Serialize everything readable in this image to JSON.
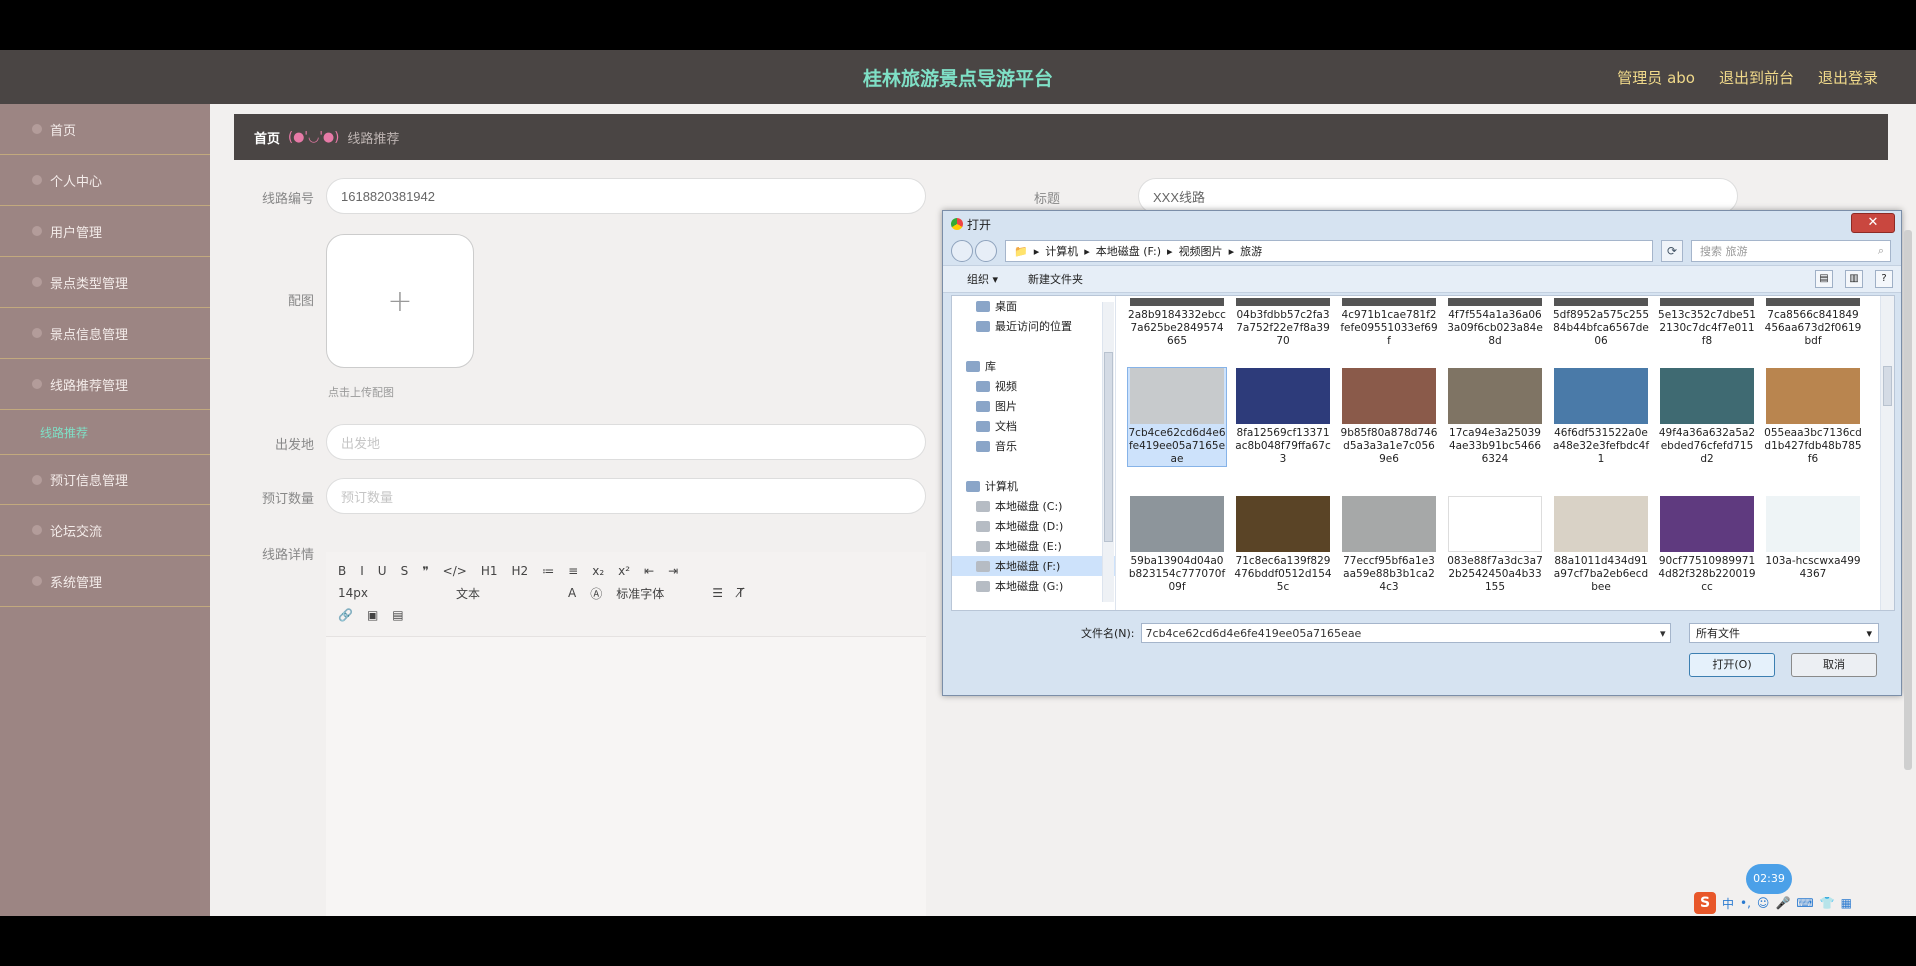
{
  "app": {
    "title": "桂林旅游景点导游平台",
    "user": "管理员 abo",
    "to_front": "退出到前台",
    "logout": "退出登录"
  },
  "sidebar": {
    "items": [
      {
        "label": "首页"
      },
      {
        "label": "个人中心"
      },
      {
        "label": "用户管理"
      },
      {
        "label": "景点类型管理"
      },
      {
        "label": "景点信息管理"
      },
      {
        "label": "线路推荐管理"
      }
    ],
    "sub_item": "线路推荐",
    "items2": [
      {
        "label": "预订信息管理"
      },
      {
        "label": "论坛交流"
      },
      {
        "label": "系统管理"
      }
    ]
  },
  "breadcrumb": {
    "home": "首页",
    "sep": "(●'◡'●)",
    "current": "线路推荐"
  },
  "form": {
    "route_no_label": "线路编号",
    "route_no_value": "1618820381942",
    "title_label": "标题",
    "title_value": "XXX线路",
    "cover_label": "配图",
    "upload_hint": "点击上传配图",
    "departure_label": "出发地",
    "departure_placeholder": "出发地",
    "quantity_label": "预订数量",
    "quantity_placeholder": "预订数量",
    "detail_label": "线路详情"
  },
  "editor": {
    "toolbar_row1": [
      "B",
      "I",
      "U",
      "S",
      "❞",
      "</>",
      "H1",
      "H2",
      "≔",
      "≡",
      "x₂",
      "x²",
      "⇤",
      "⇥"
    ],
    "font_size": "14px",
    "block_type": "文本",
    "font_family": "标准字体",
    "toolbar_row3": [
      "🔗",
      "▣",
      "▤"
    ]
  },
  "dialog": {
    "title": "打开",
    "path": [
      "计算机",
      "本地磁盘 (F:)",
      "视频图片",
      "旅游"
    ],
    "search_placeholder": "搜索 旅游",
    "organize": "组织 ▾",
    "new_folder": "新建文件夹",
    "tree": [
      {
        "label": "桌面",
        "type": "folder"
      },
      {
        "label": "最近访问的位置",
        "type": "folder"
      },
      {
        "label": "",
        "type": "spacer"
      },
      {
        "label": "库",
        "type": "lib"
      },
      {
        "label": "视频",
        "type": "folder"
      },
      {
        "label": "图片",
        "type": "folder"
      },
      {
        "label": "文档",
        "type": "folder"
      },
      {
        "label": "音乐",
        "type": "folder"
      },
      {
        "label": "",
        "type": "spacer"
      },
      {
        "label": "计算机",
        "type": "lib"
      },
      {
        "label": "本地磁盘 (C:)",
        "type": "drive"
      },
      {
        "label": "本地磁盘 (D:)",
        "type": "drive"
      },
      {
        "label": "本地磁盘 (E:)",
        "type": "drive"
      },
      {
        "label": "本地磁盘 (F:)",
        "type": "drive",
        "selected": true
      },
      {
        "label": "本地磁盘 (G:)",
        "type": "drive"
      }
    ],
    "top_row": [
      "2a8b9184332ebcc7a625be2849574665",
      "04b3fdbb57c2fa37a752f22e7f8a3970",
      "4c971b1cae781f2fefe09551033ef69f",
      "4f7f554a1a36a063a09f6cb023a84e8d",
      "5df8952a575c25584b44bfca6567de06",
      "5e13c352c7dbe512130c7dc4f7e011f8",
      "7ca8566c841849456aa673d2f0619bdf"
    ],
    "mid_row": [
      "7cb4ce62cd6d4e6fe419ee05a7165eae",
      "8fa12569cf13371ac8b048f79ffa67c3",
      "9b85f80a878d746d5a3a3a1e7c0569e6",
      "17ca94e3a250394ae33b91bc54666324",
      "46f6df531522a0ea48e32e3fefbdc4f1",
      "49f4a36a632a5a2ebded76cfefd715d2",
      "055eaa3bc7136cdd1b427fdb48b785f6"
    ],
    "bottom_row": [
      "59ba13904d04a0b823154c777070f09f",
      "71c8ec6a139f829476bddf0512d1545c",
      "77eccf95bf6a1e3aa59e88b3b1ca24c3",
      "083e88f7a3dc3a72b2542450a4b33155",
      "88a1011d434d91a97cf7ba2eb6ecdbee",
      "90cf775109899714d82f328b220019cc",
      "103a-hcscwxa4994367"
    ],
    "thumb_colors_mid": [
      "#c7cacc",
      "#2d3b7a",
      "#8a5a4a",
      "#7f7464",
      "#4a7aa8",
      "#3f6a72",
      "#b9854f"
    ],
    "thumb_colors_bottom": [
      "#8d959b",
      "#5a4426",
      "#a6a8a8",
      "#ffffff",
      "#d9d2c6",
      "#5f3a7f",
      "#eef4f6"
    ],
    "filename_label": "文件名(N):",
    "filename_value": "7cb4ce62cd6d4e6fe419ee05a7165eae",
    "filetype": "所有文件",
    "open": "打开(O)",
    "cancel": "取消"
  },
  "overlay": {
    "timer": "02:39",
    "ime_label": "中"
  }
}
